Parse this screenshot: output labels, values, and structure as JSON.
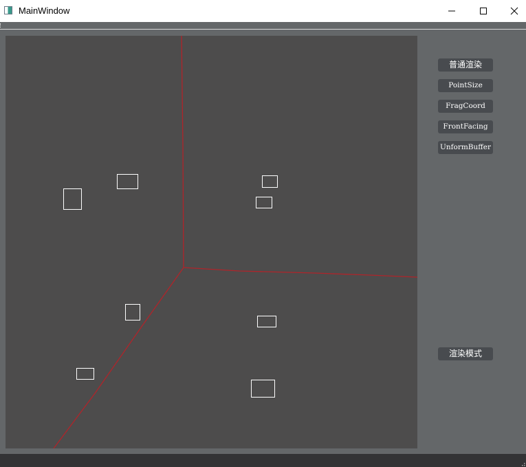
{
  "window": {
    "title": "MainWindow",
    "icon": "app-window-icon",
    "controls": [
      "minimize-icon",
      "maximize-icon",
      "close-icon"
    ]
  },
  "canvas": {
    "background": "#4d4c4c",
    "line_color": "#b0242a",
    "rect_color": "#ffffff"
  },
  "buttons": {
    "normal_render": "普通渲染",
    "point_size": "PointSize",
    "frag_coord": "FragCoord",
    "front_facing": "FrontFacing",
    "uniform_buffer": "UnformBuffer",
    "render_mode": "渲染模式"
  },
  "colors": {
    "panel_bg": "#646769",
    "button_bg": "#484b4f",
    "status_bar": "#333335"
  }
}
